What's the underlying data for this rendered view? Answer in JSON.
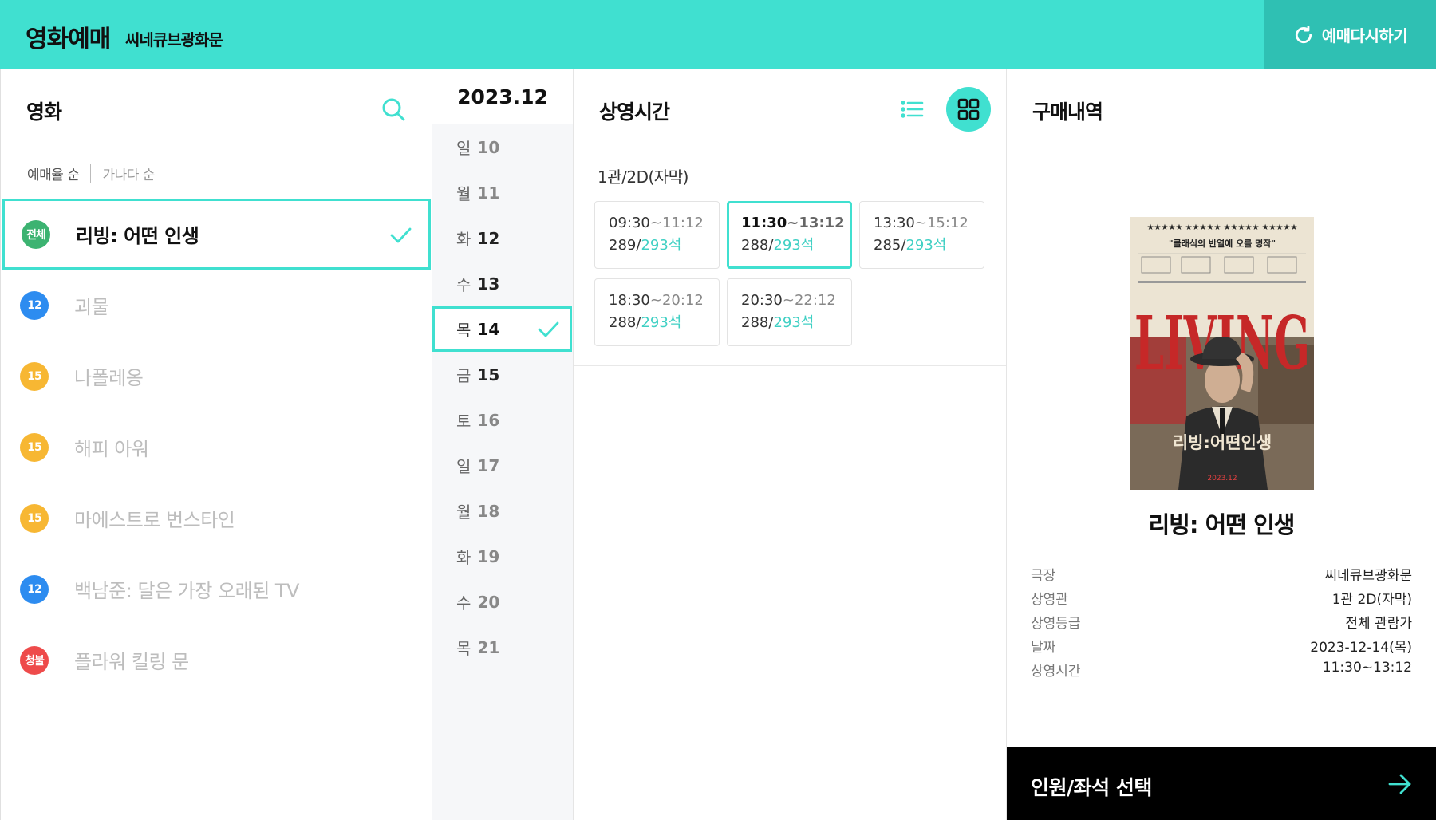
{
  "header": {
    "title": "영화예매",
    "cinema": "씨네큐브광화문",
    "reset_label": "예매다시하기"
  },
  "movies": {
    "title": "영화",
    "sort_options": [
      "예매율 순",
      "가나다 순"
    ],
    "items": [
      {
        "rating": "전체",
        "title": "리빙: 어떤 인생",
        "color": "#3CB371",
        "selected": true
      },
      {
        "rating": "12",
        "title": "괴물",
        "color": "#2D8CF0",
        "selected": false
      },
      {
        "rating": "15",
        "title": "나폴레옹",
        "color": "#F7B733",
        "selected": false
      },
      {
        "rating": "15",
        "title": "해피 아워",
        "color": "#F7B733",
        "selected": false
      },
      {
        "rating": "15",
        "title": "마에스트로 번스타인",
        "color": "#F7B733",
        "selected": false
      },
      {
        "rating": "12",
        "title": "백남준: 달은 가장 오래된 TV",
        "color": "#2D8CF0",
        "selected": false
      },
      {
        "rating": "청불",
        "title": "플라워 킬링 문",
        "color": "#EE4B4B",
        "selected": false
      }
    ]
  },
  "dates": {
    "month": "2023.12",
    "items": [
      {
        "dow": "일",
        "day": "10",
        "weekday": false,
        "selected": false
      },
      {
        "dow": "월",
        "day": "11",
        "weekday": false,
        "selected": false
      },
      {
        "dow": "화",
        "day": "12",
        "weekday": true,
        "selected": false
      },
      {
        "dow": "수",
        "day": "13",
        "weekday": true,
        "selected": false
      },
      {
        "dow": "목",
        "day": "14",
        "weekday": true,
        "selected": true
      },
      {
        "dow": "금",
        "day": "15",
        "weekday": true,
        "selected": false
      },
      {
        "dow": "토",
        "day": "16",
        "weekday": false,
        "selected": false
      },
      {
        "dow": "일",
        "day": "17",
        "weekday": false,
        "selected": false
      },
      {
        "dow": "월",
        "day": "18",
        "weekday": false,
        "selected": false
      },
      {
        "dow": "화",
        "day": "19",
        "weekday": false,
        "selected": false
      },
      {
        "dow": "수",
        "day": "20",
        "weekday": false,
        "selected": false
      },
      {
        "dow": "목",
        "day": "21",
        "weekday": false,
        "selected": false
      }
    ]
  },
  "showtimes": {
    "title": "상영시간",
    "screen": "1관/2D(자막)",
    "times": [
      {
        "start": "09:30",
        "end": "11:12",
        "remaining": "289",
        "total": "293석",
        "selected": false
      },
      {
        "start": "11:30",
        "end": "13:12",
        "remaining": "288",
        "total": "293석",
        "selected": true
      },
      {
        "start": "13:30",
        "end": "15:12",
        "remaining": "285",
        "total": "293석",
        "selected": false
      },
      {
        "start": "18:30",
        "end": "20:12",
        "remaining": "288",
        "total": "293석",
        "selected": false
      },
      {
        "start": "20:30",
        "end": "22:12",
        "remaining": "288",
        "total": "293석",
        "selected": false
      }
    ]
  },
  "summary": {
    "title": "구매내역",
    "poster": {
      "stars": "★★★★★  ★★★★★  ★★★★★  ★★★★★",
      "quote": "\"클래식의 반열에 오를 명작\"",
      "big_title": "LIVING",
      "kr_title": "리빙:어떤인생",
      "date": "2023.12"
    },
    "movie_title": "리빙: 어떤 인생",
    "info": [
      {
        "key": "극장",
        "value": "씨네큐브광화문"
      },
      {
        "key": "상영관",
        "value": "1관 2D(자막)"
      },
      {
        "key": "상영등급",
        "value": "전체 관람가"
      },
      {
        "key": "날짜",
        "value": "2023-12-14(목)"
      },
      {
        "key": "상영시간",
        "value": "11:30~13:12"
      }
    ],
    "next_label": "인원/좌석 선택"
  },
  "colors": {
    "accent": "#40E0D0",
    "accent_dark": "#2FC0B3"
  }
}
